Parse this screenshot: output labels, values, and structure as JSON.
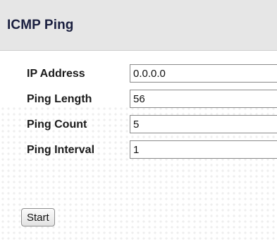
{
  "header": {
    "title": "ICMP Ping"
  },
  "form": {
    "fields": [
      {
        "label": "IP Address",
        "value": "0.0.0.0"
      },
      {
        "label": "Ping Length",
        "value": "56"
      },
      {
        "label": "Ping Count",
        "value": "5"
      },
      {
        "label": "Ping Interval",
        "value": "1"
      }
    ]
  },
  "actions": {
    "start_label": "Start"
  }
}
